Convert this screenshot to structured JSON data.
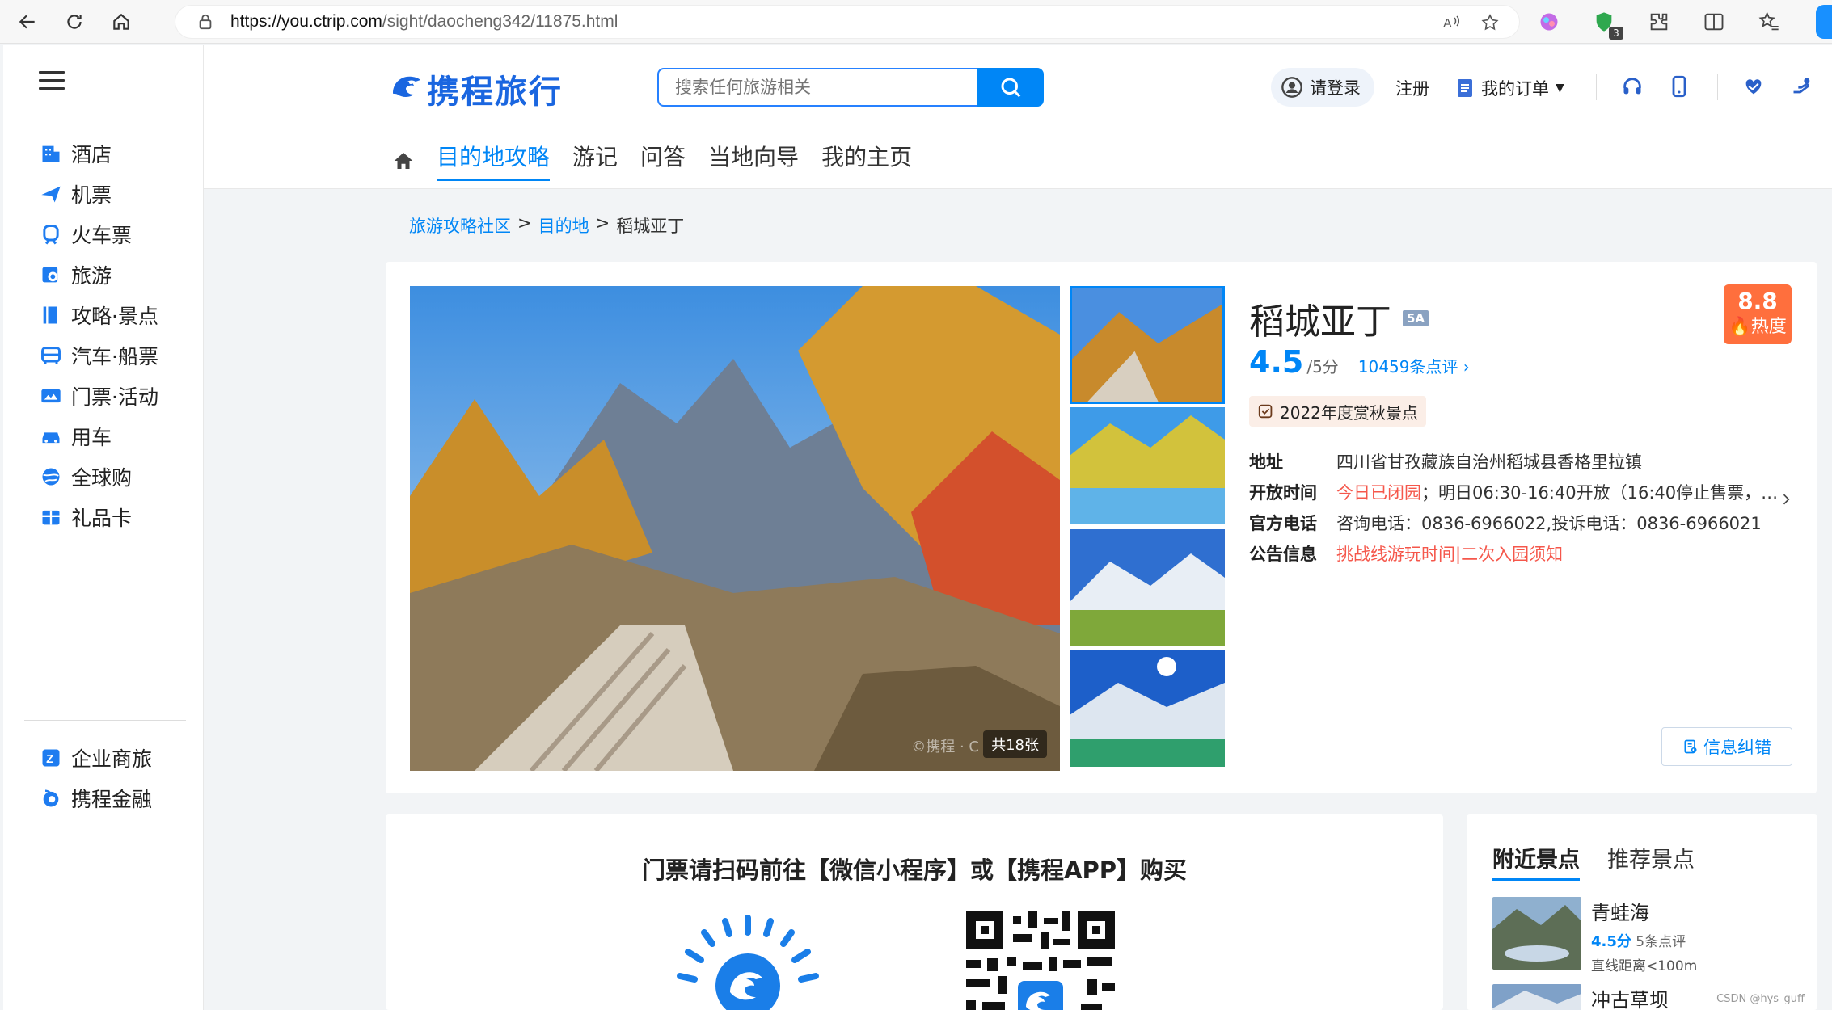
{
  "browser": {
    "url_domain": "https://you.ctrip.com",
    "url_path": "/sight/daocheng342/11875.html",
    "ext_badge": "3"
  },
  "sidebar": {
    "items": [
      {
        "label": "酒店",
        "icon": "hotel-icon"
      },
      {
        "label": "机票",
        "icon": "plane-icon"
      },
      {
        "label": "火车票",
        "icon": "train-icon"
      },
      {
        "label": "旅游",
        "icon": "travel-icon"
      },
      {
        "label": "攻略·景点",
        "icon": "guide-icon"
      },
      {
        "label": "汽车·船票",
        "icon": "bus-icon"
      },
      {
        "label": "门票·活动",
        "icon": "ticket-icon"
      },
      {
        "label": "用车",
        "icon": "car-icon"
      },
      {
        "label": "全球购",
        "icon": "globe-icon"
      },
      {
        "label": "礼品卡",
        "icon": "gift-card-icon"
      }
    ],
    "bottom_items": [
      {
        "label": "企业商旅",
        "icon": "business-icon"
      },
      {
        "label": "携程金融",
        "icon": "finance-icon"
      }
    ]
  },
  "header": {
    "logo_text": "携程旅行",
    "search_placeholder": "搜索任何旅游相关",
    "login": "请登录",
    "register": "注册",
    "orders": "我的订单",
    "nav": [
      {
        "label": "目的地攻略",
        "active": true
      },
      {
        "label": "游记",
        "active": false
      },
      {
        "label": "问答",
        "active": false
      },
      {
        "label": "当地向导",
        "active": false
      },
      {
        "label": "我的主页",
        "active": false
      }
    ]
  },
  "breadcrumb": {
    "items": [
      "旅游攻略社区",
      "目的地",
      "稻城亚丁"
    ],
    "sep": ">"
  },
  "sight": {
    "title": "稻城亚丁",
    "level": "5A",
    "heat_value": "8.8",
    "heat_label": "热度",
    "score": "4.5",
    "score_max": "/5分",
    "reviews": "10459条点评",
    "award": "2022年度赏秋景点",
    "image_count": "共18张",
    "watermark": "©携程 · C",
    "info": {
      "address_label": "地址",
      "address": "四川省甘孜藏族自治州稻城县香格里拉镇",
      "hours_label": "开放时间",
      "hours_status": "今日已闭园",
      "hours_detail": "；明日06:30-16:40开放（16:40停止售票，16:...",
      "phone_label": "官方电话",
      "phone": "咨询电话：0836-6966022,投诉电话：0836-6966021",
      "notice_label": "公告信息",
      "notice": "挑战线游玩时间|二次入园须知"
    },
    "correct_button": "信息纠错"
  },
  "ticket": {
    "title": "门票请扫码前往【微信小程序】或【携程APP】购买"
  },
  "nearby": {
    "tabs": [
      {
        "label": "附近景点",
        "active": true
      },
      {
        "label": "推荐景点",
        "active": false
      }
    ],
    "items": [
      {
        "name": "青蛙海",
        "score": "4.5分",
        "reviews": "5条点评",
        "distance": "直线距离<100m"
      },
      {
        "name": "冲古草坝",
        "score": "",
        "reviews": "",
        "distance": ""
      }
    ]
  },
  "footer_watermark": "CSDN @hys_guff",
  "colors": {
    "brand_blue": "#0086f6",
    "heat_orange": "#ff6f3d",
    "alert_red": "#f5574b"
  }
}
